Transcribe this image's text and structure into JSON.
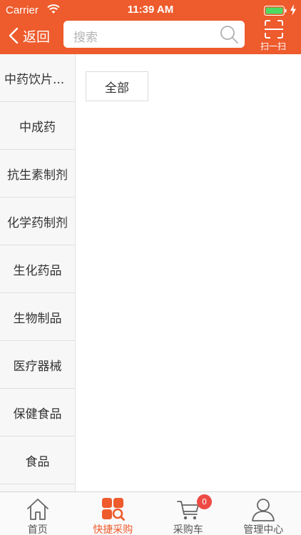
{
  "status_bar": {
    "carrier": "Carrier",
    "time": "11:39 AM"
  },
  "nav": {
    "back_label": "返回",
    "search_placeholder": "搜索",
    "scan_label": "扫一扫"
  },
  "sidebar": {
    "items": [
      {
        "label": "中药饮片..."
      },
      {
        "label": "中成药"
      },
      {
        "label": "抗生素制剂"
      },
      {
        "label": "化学药制剂"
      },
      {
        "label": "生化药品"
      },
      {
        "label": "生物制品"
      },
      {
        "label": "医疗器械"
      },
      {
        "label": "保健食品"
      },
      {
        "label": "食品"
      }
    ]
  },
  "content": {
    "chip_label": "全部"
  },
  "tabbar": {
    "tabs": [
      {
        "label": "首页",
        "icon": "home-icon"
      },
      {
        "label": "快捷采购",
        "icon": "quick-purchase-icon",
        "active": true
      },
      {
        "label": "采购车",
        "icon": "cart-icon"
      },
      {
        "label": "管理中心",
        "icon": "user-icon"
      }
    ],
    "cart_badge": "0"
  },
  "colors": {
    "accent": "#ee5b2c",
    "badge": "#ee4a44"
  }
}
